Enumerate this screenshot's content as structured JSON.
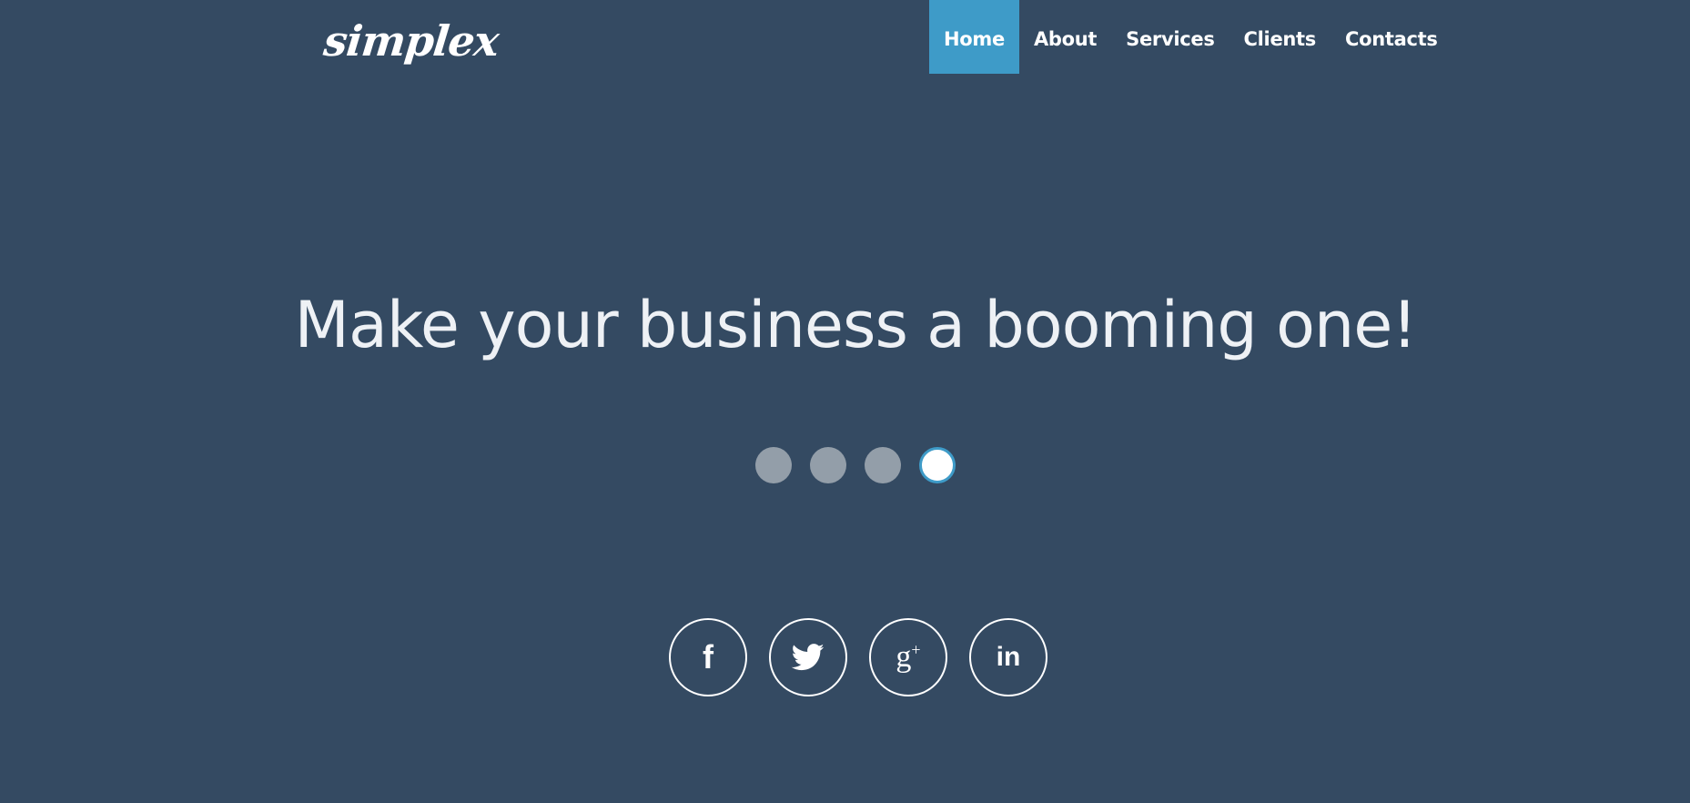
{
  "brand": {
    "logo_text": "simplex"
  },
  "nav": {
    "items": [
      {
        "label": "Home",
        "active": true
      },
      {
        "label": "About",
        "active": false
      },
      {
        "label": "Services",
        "active": false
      },
      {
        "label": "Clients",
        "active": false
      },
      {
        "label": "Contacts",
        "active": false
      }
    ]
  },
  "hero": {
    "headline": "Make your business a booming one!"
  },
  "slider": {
    "slide_count": 4,
    "active_index": 3
  },
  "social": {
    "items": [
      {
        "icon": "facebook-icon",
        "glyph": "f"
      },
      {
        "icon": "twitter-icon",
        "glyph": ""
      },
      {
        "icon": "google-plus-icon",
        "glyph": "g",
        "suffix": "+"
      },
      {
        "icon": "linkedin-icon",
        "glyph": "in"
      }
    ]
  },
  "colors": {
    "background": "#344a62",
    "accent": "#3e9bc8",
    "inactive_dot": "#939ea9",
    "text": "#ffffff"
  }
}
